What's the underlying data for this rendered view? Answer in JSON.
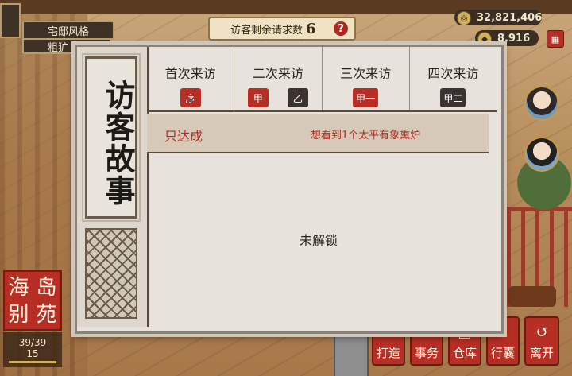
{
  "top_left": {
    "style_label": "宅邸风格",
    "style_value": "粗犷"
  },
  "requests": {
    "label": "访客剩余请求数",
    "count": "6",
    "help": "?"
  },
  "currency": {
    "coins": "32,821,406",
    "gems": "8,916"
  },
  "location": {
    "name_chars": [
      "海",
      "岛",
      "别",
      "苑"
    ],
    "capacity": "39/39",
    "level": "15"
  },
  "bottom_menu": {
    "items": [
      {
        "label": "打造",
        "icon": "hammer-icon"
      },
      {
        "label": "事务",
        "icon": "scroll-icon"
      },
      {
        "label": "仓库",
        "icon": "box-icon"
      },
      {
        "label": "行囊",
        "icon": "bag-icon"
      },
      {
        "label": "离开",
        "icon": "return-icon"
      }
    ]
  },
  "modal": {
    "title": "访客故事",
    "tabs": [
      {
        "label": "首次来访",
        "chips": [
          {
            "text": "序",
            "color": "red"
          }
        ]
      },
      {
        "label": "二次来访",
        "chips": [
          {
            "text": "甲",
            "color": "red"
          },
          {
            "text": "乙",
            "color": "dark"
          }
        ]
      },
      {
        "label": "三次来访",
        "chips": [
          {
            "text": "甲一",
            "color": "red"
          }
        ]
      },
      {
        "label": "四次来访",
        "chips": [
          {
            "text": "甲二",
            "color": "dark"
          }
        ]
      }
    ],
    "story": {
      "status": "只达成",
      "description": "想看到1个太平有象熏炉"
    },
    "locked_text": "未解锁"
  }
}
